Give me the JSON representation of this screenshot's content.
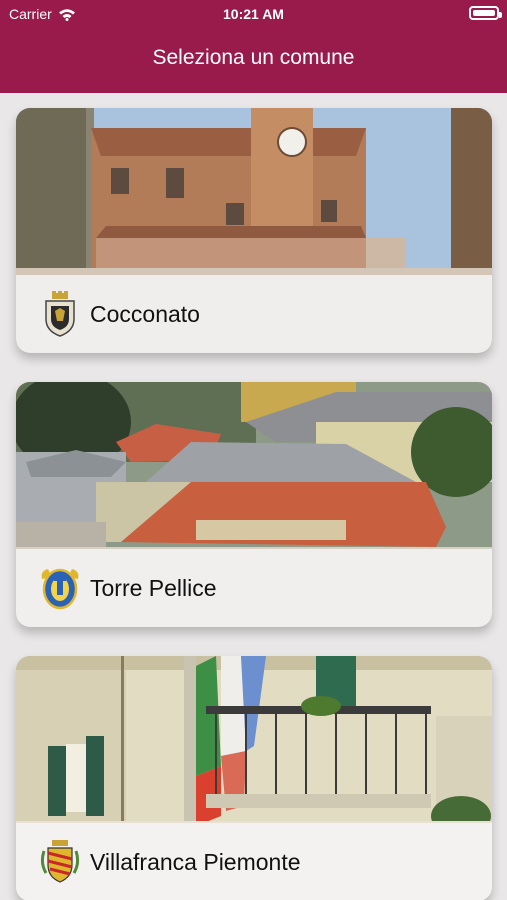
{
  "status_bar": {
    "carrier": "Carrier",
    "time": "10:21 AM"
  },
  "header": {
    "title": "Seleziona un comune"
  },
  "comuni": [
    {
      "name": "Cocconato"
    },
    {
      "name": "Torre Pellice"
    },
    {
      "name": "Villafranca Piemonte"
    }
  ],
  "colors": {
    "header": "#981b4c",
    "background": "#e9e7e7"
  }
}
